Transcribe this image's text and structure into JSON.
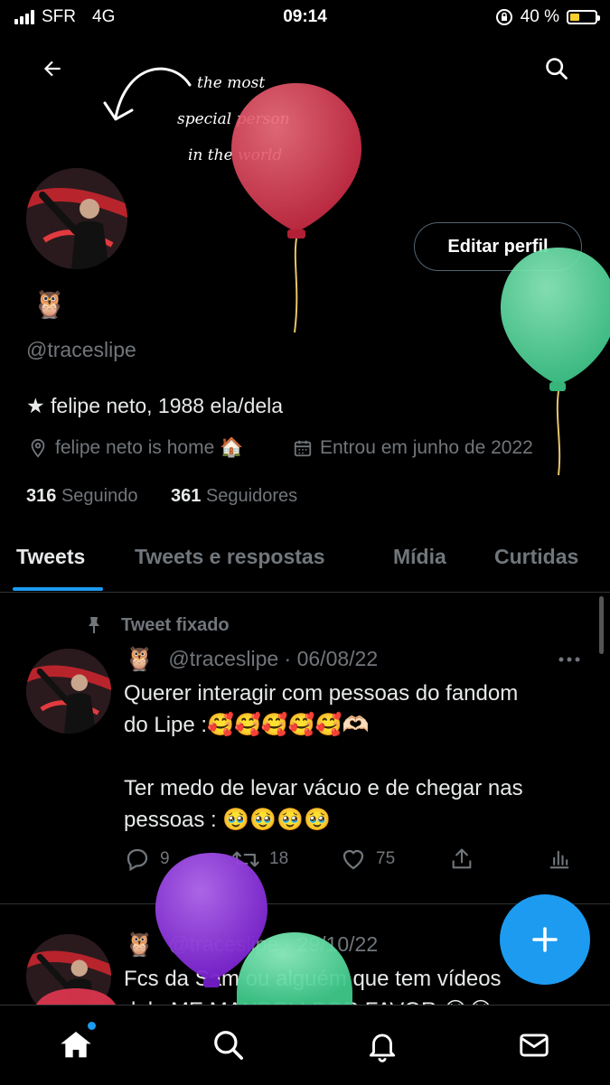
{
  "status_bar": {
    "carrier": "SFR",
    "network": "4G",
    "time": "09:14",
    "battery_percent": "40 %",
    "battery_level": 0.4
  },
  "header": {
    "back_icon": "arrow-left-icon",
    "search_icon": "search-icon",
    "banner_text": [
      "the most",
      "special person",
      "in the world"
    ]
  },
  "profile": {
    "emoji": "🦉",
    "handle": "@traceslipe",
    "edit_button_label": "Editar perfil",
    "bio": "★ felipe neto, 1988 ela/dela",
    "location": "felipe neto is home 🏠",
    "joined": "Entrou em junho de 2022",
    "following_count": "316",
    "following_label": "Seguindo",
    "followers_count": "361",
    "followers_label": "Seguidores"
  },
  "tabs": [
    {
      "label": "Tweets",
      "active": true
    },
    {
      "label": "Tweets e respostas",
      "active": false
    },
    {
      "label": "Mídia",
      "active": false
    },
    {
      "label": "Curtidas",
      "active": false
    }
  ],
  "tweets": [
    {
      "pinned_label": "Tweet fixado",
      "emoji": "🦉",
      "handle_date": "@traceslipe · 06/08/22",
      "text_line1": "Querer interagir com pessoas do fandom",
      "text_line2": "do Lipe :🥰🥰🥰🥰🥰🫶🏻",
      "text_line3": "Ter medo de levar vácuo e de chegar nas",
      "text_line4": "pessoas : 🥹🥹🥹🥹",
      "replies": "9",
      "retweets": "18",
      "likes": "75"
    },
    {
      "emoji": "🦉",
      "handle_date": "@traceslipe · 29/10/22",
      "text_line1": "Fcs da Sam ou alguém que tem vídeos",
      "text_line2": "dela ME MANDEM POR FAVOR 😭😭"
    }
  ],
  "balloons": [
    {
      "name": "red-balloon",
      "color": "#d9364e"
    },
    {
      "name": "green-balloon",
      "color": "#54d59a"
    },
    {
      "name": "purple-balloon",
      "color": "#8a2be2"
    },
    {
      "name": "green-balloon-2",
      "color": "#54d59a"
    }
  ],
  "accent_color": "#1d9bf0",
  "bottom_nav": [
    "home-icon",
    "search-icon",
    "bell-icon",
    "mail-icon"
  ]
}
